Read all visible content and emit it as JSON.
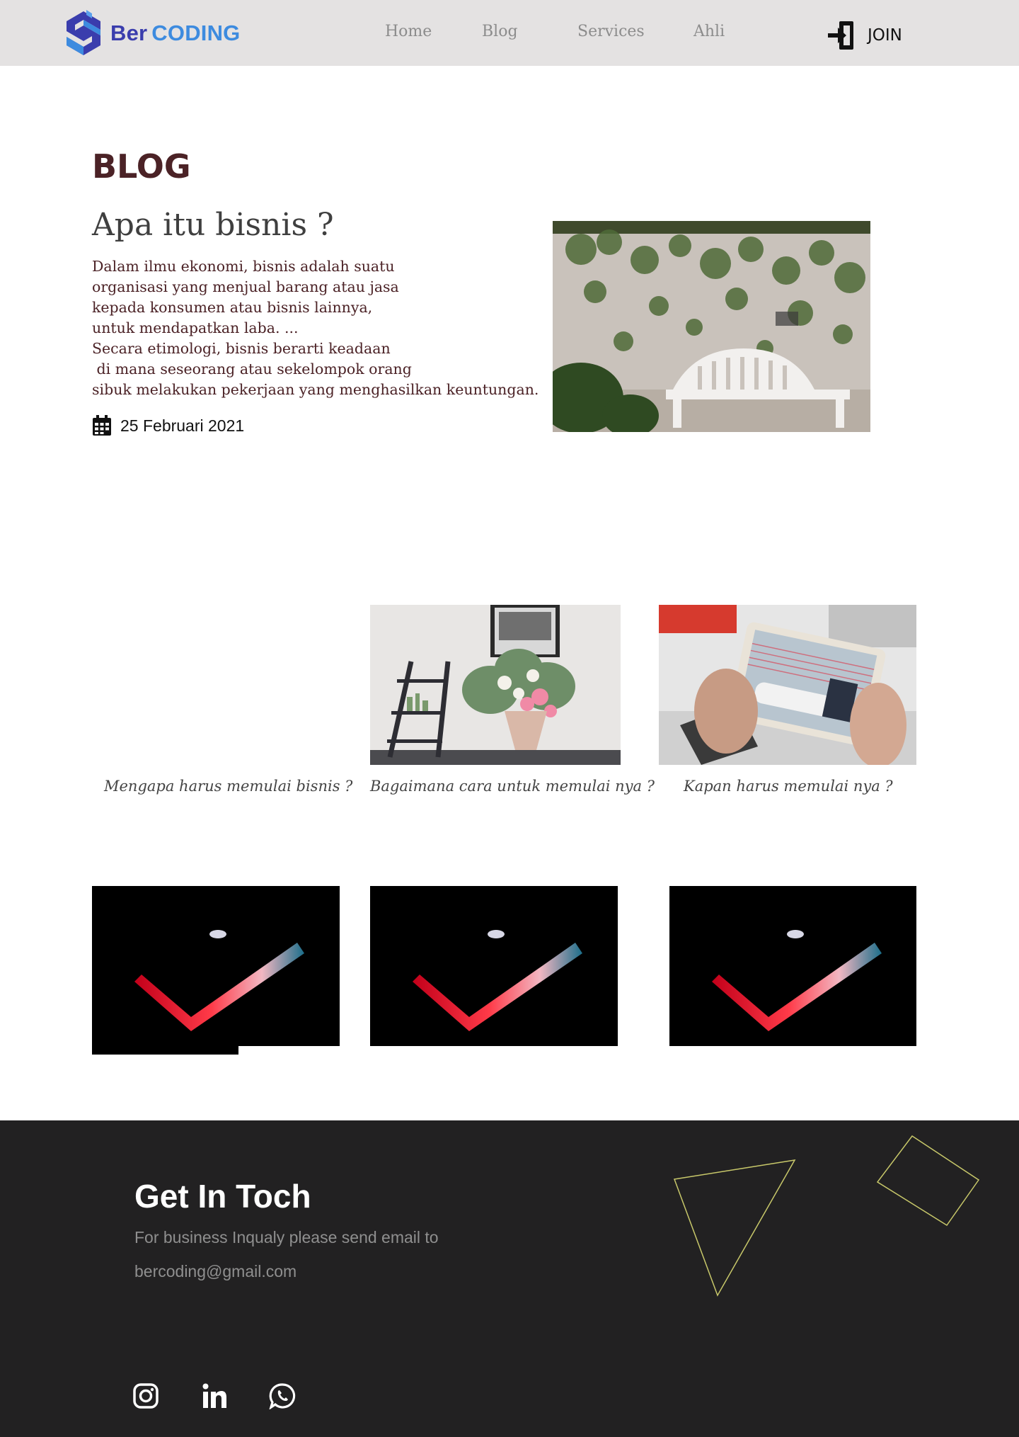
{
  "nav": {
    "logo_part1": "Ber",
    "logo_part2": "CODING",
    "links": [
      "Home",
      "Blog",
      "Services",
      "Ahli"
    ],
    "join_label": "JOIN"
  },
  "blog": {
    "heading": "BLOG",
    "article": {
      "title": "Apa itu bisnis ?",
      "body_lines": [
        "Dalam ilmu ekonomi, bisnis adalah suatu",
        "organisasi yang menjual barang atau jasa",
        "kepada konsumen atau bisnis lainnya,",
        "untuk mendapatkan laba. ...",
        "Secara etimologi, bisnis berarti keadaan",
        " di mana seseorang atau sekelompok orang",
        "sibuk melakukan pekerjaan yang menghasilkan keuntungan."
      ],
      "date": "25 Februari 2021"
    }
  },
  "cards": [
    {
      "caption": "Mengapa harus memulai bisnis ?"
    },
    {
      "caption": "Bagaimana cara untuk memulai nya ?"
    },
    {
      "caption": "Kapan harus memulai nya ?"
    }
  ],
  "footer": {
    "title": "Get In Toch",
    "subtitle": "For business Inqualy please send email to",
    "email": "bercoding@gmail.com",
    "social_icons": [
      "instagram-icon",
      "linkedin-icon",
      "whatsapp-icon"
    ]
  },
  "colors": {
    "nav_bg": "#e4e2e2",
    "brand_dark": "#3a3dad",
    "brand_light": "#3d8bdf",
    "heading_maroon": "#4b2226",
    "footer_bg": "#222122",
    "deco_line": "#c8c86a"
  }
}
